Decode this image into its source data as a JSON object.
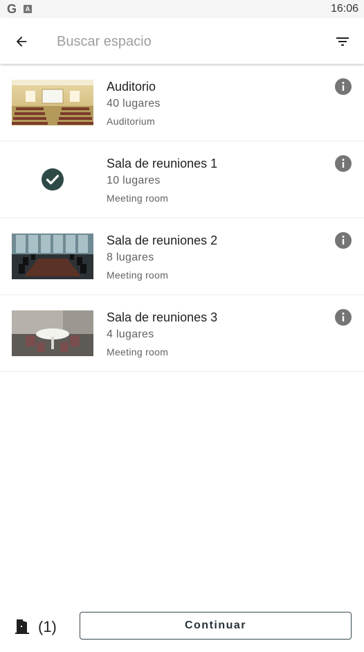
{
  "status_bar": {
    "time": "16:06",
    "icons": [
      "google-icon",
      "a-icon"
    ]
  },
  "search": {
    "placeholder": "Buscar espacio",
    "value": ""
  },
  "colors": {
    "accent": "#263238",
    "check_bg": "#2e4a47",
    "info_icon": "#757575"
  },
  "rooms": [
    {
      "name": "Auditorio",
      "capacity": "40 lugares",
      "type": "Auditorium",
      "selected": false,
      "image": "auditorium-photo"
    },
    {
      "name": "Sala de reuniones 1",
      "capacity": "10 lugares",
      "type": "Meeting room",
      "selected": true,
      "image": "check-circle-icon"
    },
    {
      "name": "Sala de reuniones 2",
      "capacity": "8 lugares",
      "type": "Meeting room",
      "selected": false,
      "image": "boardroom-photo"
    },
    {
      "name": "Sala de reuniones 3",
      "capacity": "4 lugares",
      "type": "Meeting room",
      "selected": false,
      "image": "round-table-photo"
    }
  ],
  "footer": {
    "selected_count": "(1)",
    "continue_label": "Continuar"
  }
}
